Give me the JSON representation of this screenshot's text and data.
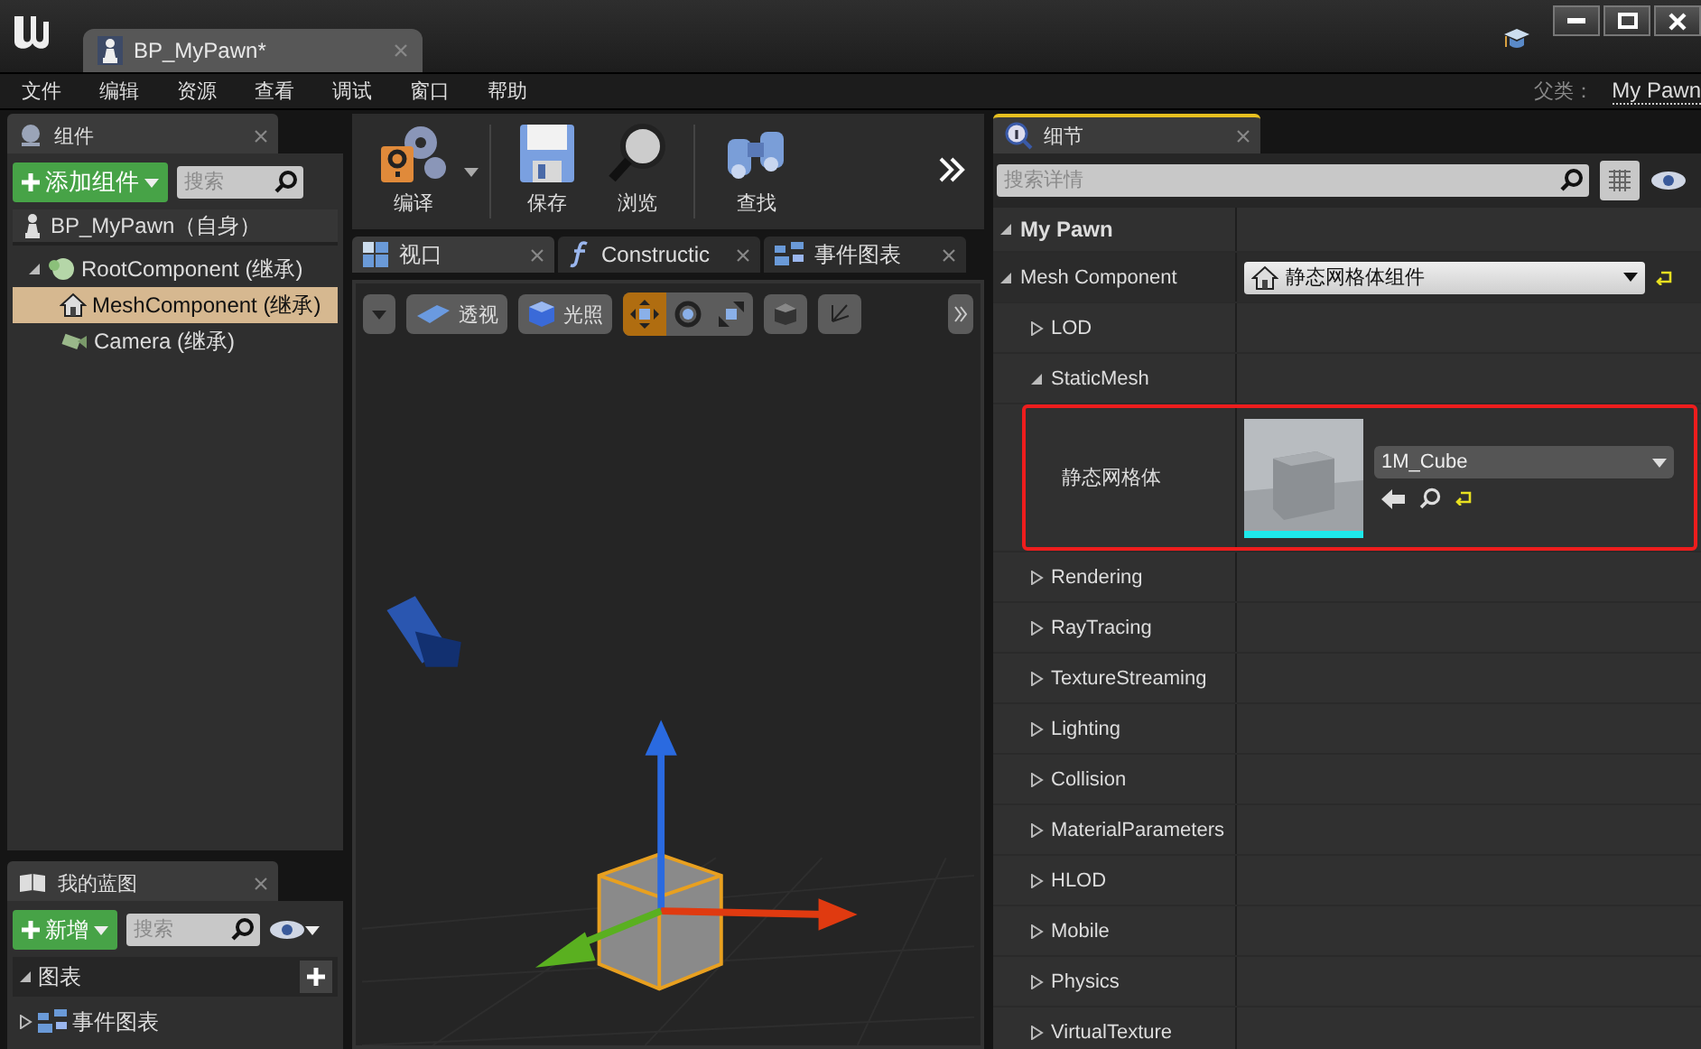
{
  "window": {
    "tab_title": "BP_MyPawn*"
  },
  "menu": [
    "文件",
    "编辑",
    "资源",
    "查看",
    "调试",
    "窗口",
    "帮助"
  ],
  "parent_class": {
    "label": "父类：",
    "value": "My Pawn"
  },
  "components_panel": {
    "tab": "组件",
    "active": false,
    "add_button": "添加组件",
    "search_placeholder": "搜索",
    "tree": [
      {
        "label": "BP_MyPawn（自身）",
        "kind": "pawn",
        "selected": false
      },
      {
        "label": "RootComponent (继承)",
        "kind": "sphere",
        "selected": false,
        "expanded": true,
        "children": [
          {
            "label": "MeshComponent (继承)",
            "kind": "mesh",
            "selected": true
          },
          {
            "label": "Camera (继承)",
            "kind": "camera",
            "selected": false
          }
        ]
      }
    ]
  },
  "toolbar": [
    {
      "label": "编译",
      "kind": "compile"
    },
    {
      "label": "保存",
      "kind": "save"
    },
    {
      "label": "浏览",
      "kind": "browse"
    },
    {
      "label": "查找",
      "kind": "find"
    }
  ],
  "editor_tabs": [
    {
      "label": "视口",
      "kind": "viewport",
      "selected": true
    },
    {
      "label": "Constructic",
      "kind": "function",
      "selected": false
    },
    {
      "label": "事件图表",
      "kind": "graph",
      "selected": false
    }
  ],
  "viewport_toolbar": {
    "view_buttons": [
      {
        "label": "透视",
        "kind": "perspective"
      },
      {
        "label": "光照",
        "kind": "lit"
      }
    ],
    "transform_tools": [
      {
        "kind": "move",
        "selected": true
      },
      {
        "kind": "rotate",
        "selected": false
      },
      {
        "kind": "scale",
        "selected": false
      }
    ]
  },
  "my_blueprint": {
    "tab": "我的蓝图",
    "active": false,
    "add_button": "新增",
    "search_placeholder": "搜索",
    "sections": [
      {
        "label": "图表",
        "expanded": true,
        "items": [
          {
            "label": "事件图表",
            "expanded": false
          }
        ]
      }
    ]
  },
  "details": {
    "tab": "细节",
    "active": true,
    "search_placeholder": "搜索详情",
    "category": {
      "label": "My Pawn",
      "expanded": true
    },
    "component": {
      "label": "Mesh Component",
      "value": "静态网格体组件",
      "expanded": true
    },
    "groups": [
      {
        "label": "LOD",
        "expanded": false
      },
      {
        "label": "StaticMesh",
        "expanded": true,
        "properties": [
          {
            "label": "静态网格体",
            "value": "1M_Cube",
            "highlighted": true
          }
        ]
      },
      {
        "label": "Rendering",
        "expanded": false
      },
      {
        "label": "RayTracing",
        "expanded": false
      },
      {
        "label": "TextureStreaming",
        "expanded": false
      },
      {
        "label": "Lighting",
        "expanded": false
      },
      {
        "label": "Collision",
        "expanded": false
      },
      {
        "label": "MaterialParameters",
        "expanded": false
      },
      {
        "label": "HLOD",
        "expanded": false
      },
      {
        "label": "Mobile",
        "expanded": false
      },
      {
        "label": "Physics",
        "expanded": false
      },
      {
        "label": "VirtualTexture",
        "expanded": false
      }
    ]
  }
}
